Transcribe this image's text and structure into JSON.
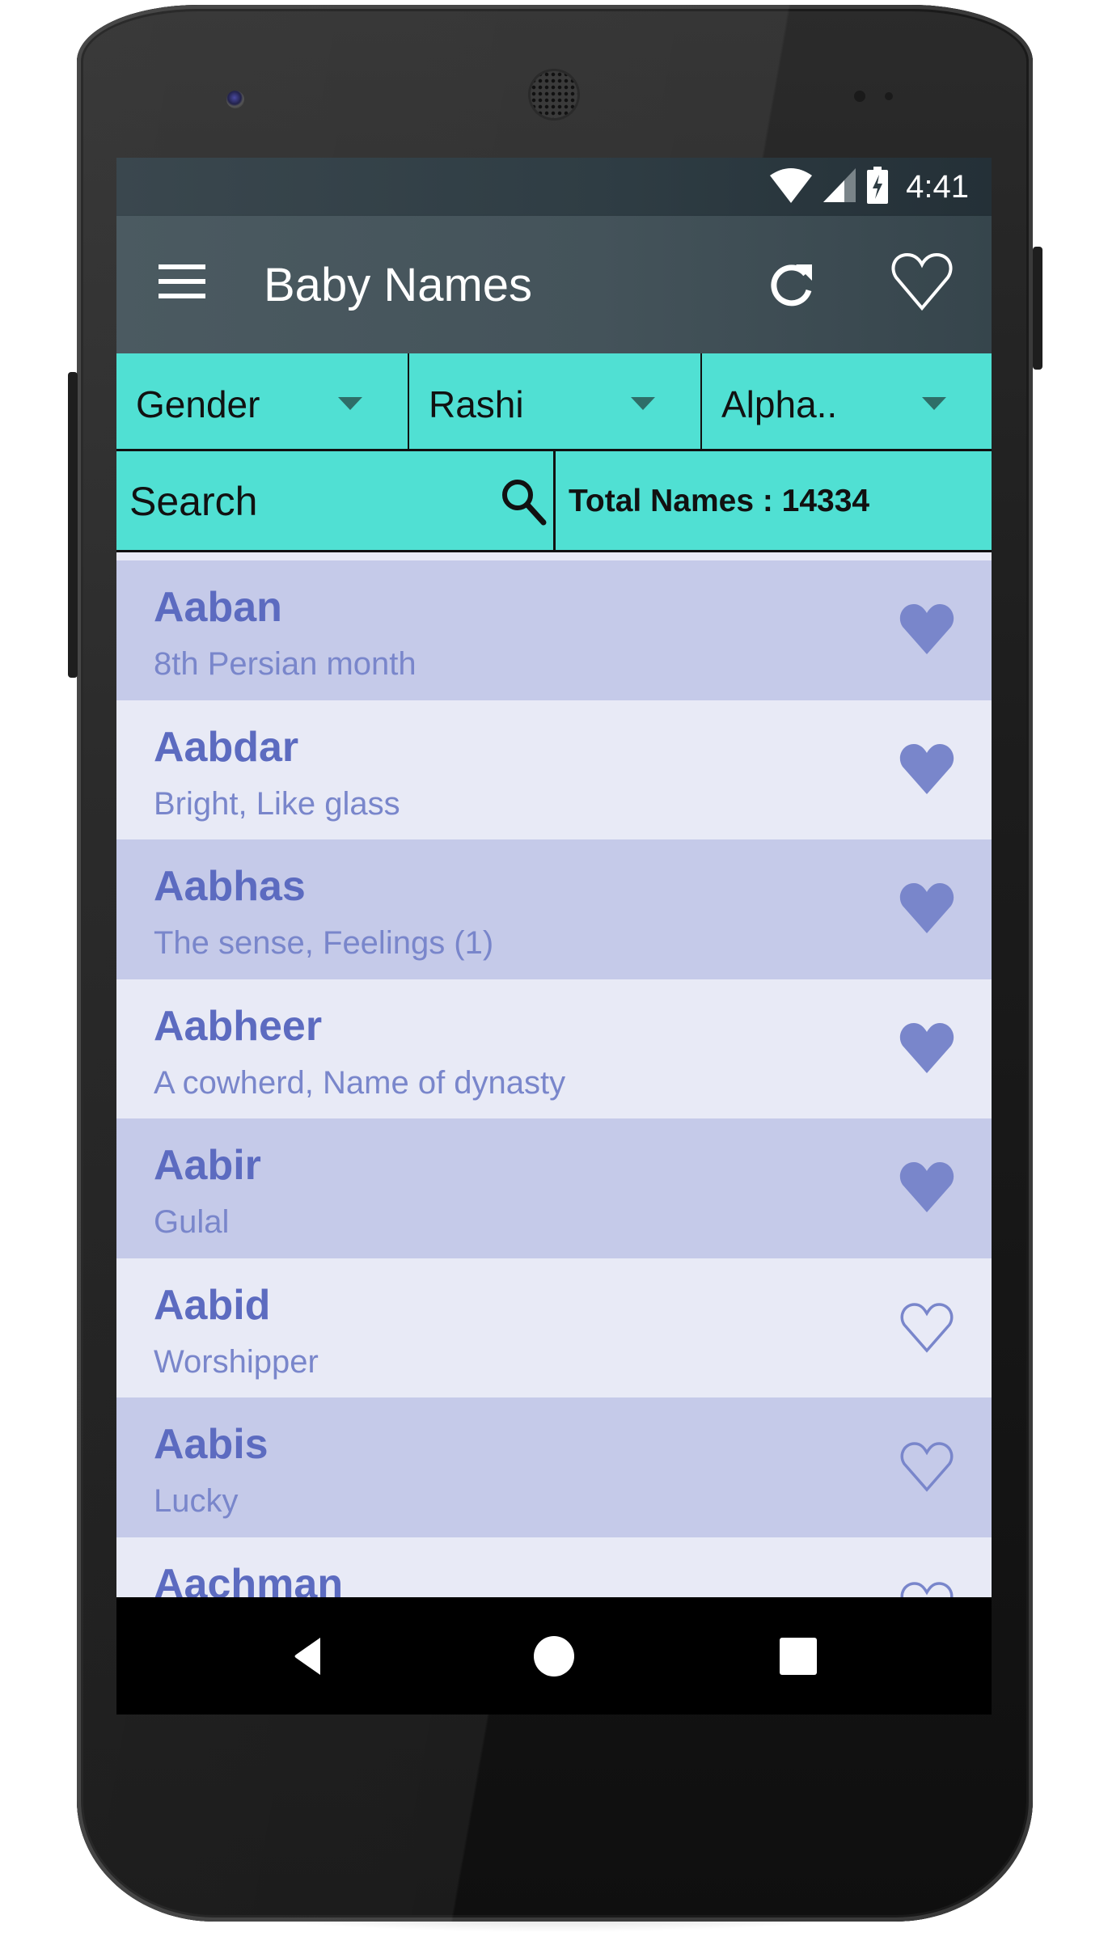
{
  "status_bar": {
    "time": "4:41",
    "icons": [
      "wifi-icon",
      "cell-signal-icon",
      "battery-charging-icon"
    ]
  },
  "app_bar": {
    "menu_icon": "hamburger-menu-icon",
    "title": "Baby Names",
    "refresh_icon": "refresh-icon",
    "favorites_icon": "heart-outline-icon"
  },
  "filters": {
    "gender": "Gender",
    "rashi": "Rashi",
    "alphabet": "Alpha.."
  },
  "search": {
    "placeholder": "Search",
    "value": "",
    "icon": "search-icon"
  },
  "total_names_label": "Total Names : 14334",
  "colors": {
    "accent": "#50e0d3",
    "app_bar": "#455a64",
    "row_odd": "#c5cae9",
    "row_even": "#e8eaf6",
    "name_text": "#5c6bc0",
    "meaning_text": "#7986cb"
  },
  "names": [
    {
      "name": "Aaban",
      "meaning": "8th Persian month",
      "favorite": true
    },
    {
      "name": "Aabdar",
      "meaning": "Bright, Like glass",
      "favorite": true
    },
    {
      "name": "Aabhas",
      "meaning": "The sense, Feelings (1)",
      "favorite": true
    },
    {
      "name": "Aabheer",
      "meaning": "A cowherd, Name of dynasty",
      "favorite": true
    },
    {
      "name": "Aabir",
      "meaning": "Gulal",
      "favorite": true
    },
    {
      "name": "Aabid",
      "meaning": "Worshipper",
      "favorite": false
    },
    {
      "name": "Aabis",
      "meaning": "Lucky",
      "favorite": false
    },
    {
      "name": "Aachman",
      "meaning": "",
      "favorite": false
    }
  ],
  "nav_bar": {
    "buttons": [
      "back-icon",
      "home-icon",
      "recents-icon"
    ]
  }
}
